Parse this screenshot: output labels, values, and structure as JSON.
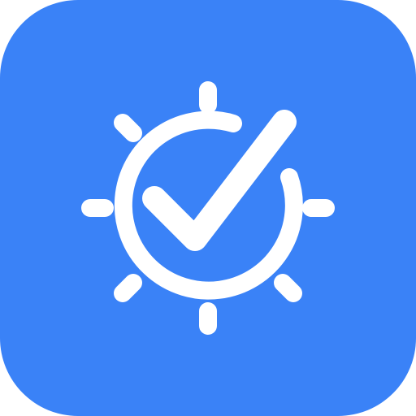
{
  "icon": {
    "name": "gear-checkmark-icon",
    "background_color": "#3a82f7",
    "glyph_color": "#ffffff"
  }
}
